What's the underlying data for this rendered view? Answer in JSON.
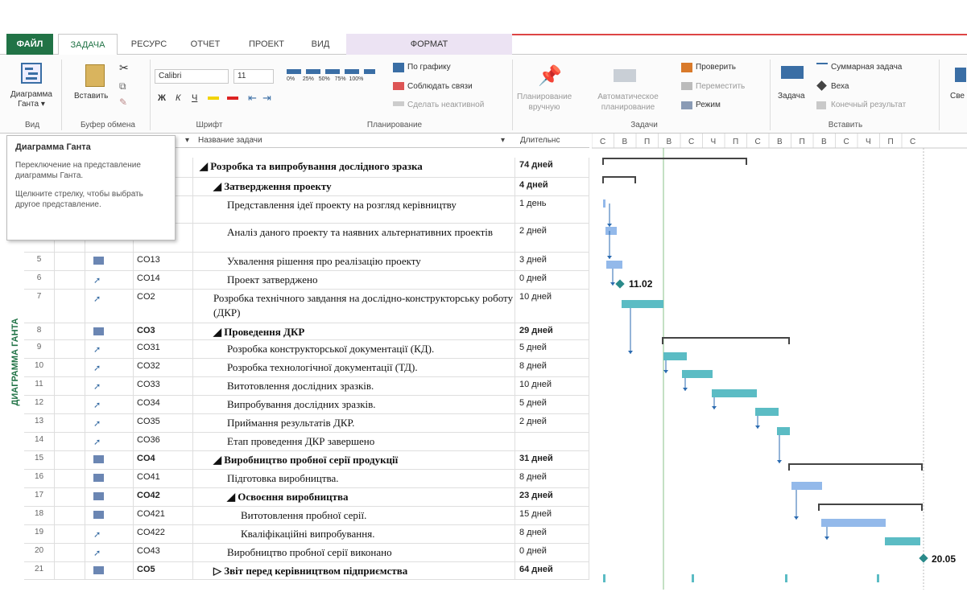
{
  "tabs": [
    "ФАЙЛ",
    "ЗАДАЧА",
    "РЕСУРС",
    "ОТЧЕТ",
    "ПРОЕКТ",
    "ВИД",
    "ФОРМАТ"
  ],
  "ribbon": {
    "view_btn": "Диаграмма Ганта ▾",
    "view_group": "Вид",
    "paste_btn": "Вставить",
    "clipboard_group": "Буфер обмена",
    "font_name": "Calibri",
    "font_size": "11",
    "bold": "Ж",
    "italic": "К",
    "underline": "Ч",
    "font_group": "Шрифт",
    "pct_labels": [
      "0%",
      "25%",
      "50%",
      "75%",
      "100%"
    ],
    "schedule_cmd1": "По графику",
    "schedule_cmd2": "Соблюдать связи",
    "schedule_cmd3": "Сделать неактивной",
    "schedule_group": "Планирование",
    "manual_label": "Планирование вручную",
    "auto_label": "Автоматическое планирование",
    "tasks_group": "Задачи",
    "check_cmd": "Проверить",
    "move_cmd": "Переместить",
    "mode_cmd": "Режим",
    "task_btn": "Задача",
    "summary_cmd": "Суммарная задача",
    "milestone_cmd": "Веха",
    "deliverable_cmd": "Конечный результат",
    "insert_group": "Вставить",
    "cut_label": "Све"
  },
  "tooltip": {
    "title": "Диаграмма Ганта",
    "desc": "Переключение на представление диаграммы Ганта.",
    "hint": "Щелкните стрелку, чтобы выбрать другое представление."
  },
  "grid_header": {
    "name": "Название задачи",
    "duration": "Длительнс"
  },
  "timescale": [
    "С",
    "В",
    "П",
    "В",
    "С",
    "Ч",
    "П",
    "С",
    "В",
    "П",
    "В",
    "С",
    "Ч",
    "П",
    "С"
  ],
  "sidebar_label": "ДИАГРАММА ГАНТА",
  "rows": [
    {
      "n": "",
      "code": "",
      "name": "◢ Розробка та випробування дослідного зразка",
      "dur": "74 дней",
      "bold": true,
      "indent": 0
    },
    {
      "n": "",
      "code": "",
      "name": "◢ Затвердження проекту",
      "dur": "4 дней",
      "bold": true,
      "indent": 1
    },
    {
      "n": "",
      "code": "",
      "name": "Представлення ідеї проекту на розгляд керівництву",
      "dur": "1 день",
      "bold": false,
      "indent": 2
    },
    {
      "n": "",
      "code": "",
      "name": "Аналіз даного проекту та наявних альтернативних проектів",
      "dur": "2 дней",
      "bold": false,
      "indent": 2
    },
    {
      "n": "5",
      "code": "CO13",
      "name": "Ухвалення рішення про реалізацію проекту",
      "dur": "3 дней",
      "bold": false,
      "indent": 2
    },
    {
      "n": "6",
      "code": "CO14",
      "name": "Проект затверджено",
      "dur": "0 дней",
      "bold": false,
      "indent": 2
    },
    {
      "n": "7",
      "code": "CO2",
      "name": "Розробка технічного завдання на дослідно-конструкторську роботу (ДКР)",
      "dur": "10 дней",
      "bold": false,
      "indent": 1
    },
    {
      "n": "8",
      "code": "CO3",
      "name": "◢ Проведення ДКР",
      "dur": "29 дней",
      "bold": true,
      "indent": 1
    },
    {
      "n": "9",
      "code": "CO31",
      "name": "Розробка конструкторської документації (КД).",
      "dur": "5 дней",
      "bold": false,
      "indent": 2
    },
    {
      "n": "10",
      "code": "CO32",
      "name": "Розробка технологічної документації (ТД).",
      "dur": "8 дней",
      "bold": false,
      "indent": 2
    },
    {
      "n": "11",
      "code": "CO33",
      "name": "Витотовлення дослідних зразків.",
      "dur": "10 дней",
      "bold": false,
      "indent": 2
    },
    {
      "n": "12",
      "code": "CO34",
      "name": "Випробування дослідних зразків.",
      "dur": "5 дней",
      "bold": false,
      "indent": 2
    },
    {
      "n": "13",
      "code": "CO35",
      "name": "Приймання результатів ДКР.",
      "dur": "2 дней",
      "bold": false,
      "indent": 2
    },
    {
      "n": "14",
      "code": "CO36",
      "name": "Етап проведення ДКР завершено",
      "dur": "",
      "bold": false,
      "indent": 2
    },
    {
      "n": "15",
      "code": "CO4",
      "name": "◢ Виробництво пробної серії продукції",
      "dur": "31 дней",
      "bold": true,
      "indent": 1
    },
    {
      "n": "16",
      "code": "CO41",
      "name": "Підготовка виробництва.",
      "dur": "8 дней",
      "bold": false,
      "indent": 2
    },
    {
      "n": "17",
      "code": "CO42",
      "name": "◢ Освоєння виробництва",
      "dur": "23 дней",
      "bold": true,
      "indent": 2
    },
    {
      "n": "18",
      "code": "CO421",
      "name": "Витотовлення пробної серії.",
      "dur": "15 дней",
      "bold": false,
      "indent": 3
    },
    {
      "n": "19",
      "code": "CO422",
      "name": "Кваліфікаційні випробування.",
      "dur": "8 дней",
      "bold": false,
      "indent": 3
    },
    {
      "n": "20",
      "code": "CO43",
      "name": "Виробництво пробної серії виконано",
      "dur": "0 дней",
      "bold": false,
      "indent": 2
    },
    {
      "n": "21",
      "code": "CO5",
      "name": "▷ Звіт перед керівництвом підприємства",
      "dur": "64 дней",
      "bold": true,
      "indent": 1
    }
  ],
  "milestones": {
    "m1": "11.02",
    "m2": "20.05"
  },
  "colors": {
    "accent": "#217346",
    "bar_auto": "#5bbcc4",
    "bar_manual": "#93b9ea",
    "summary": "#444444"
  }
}
